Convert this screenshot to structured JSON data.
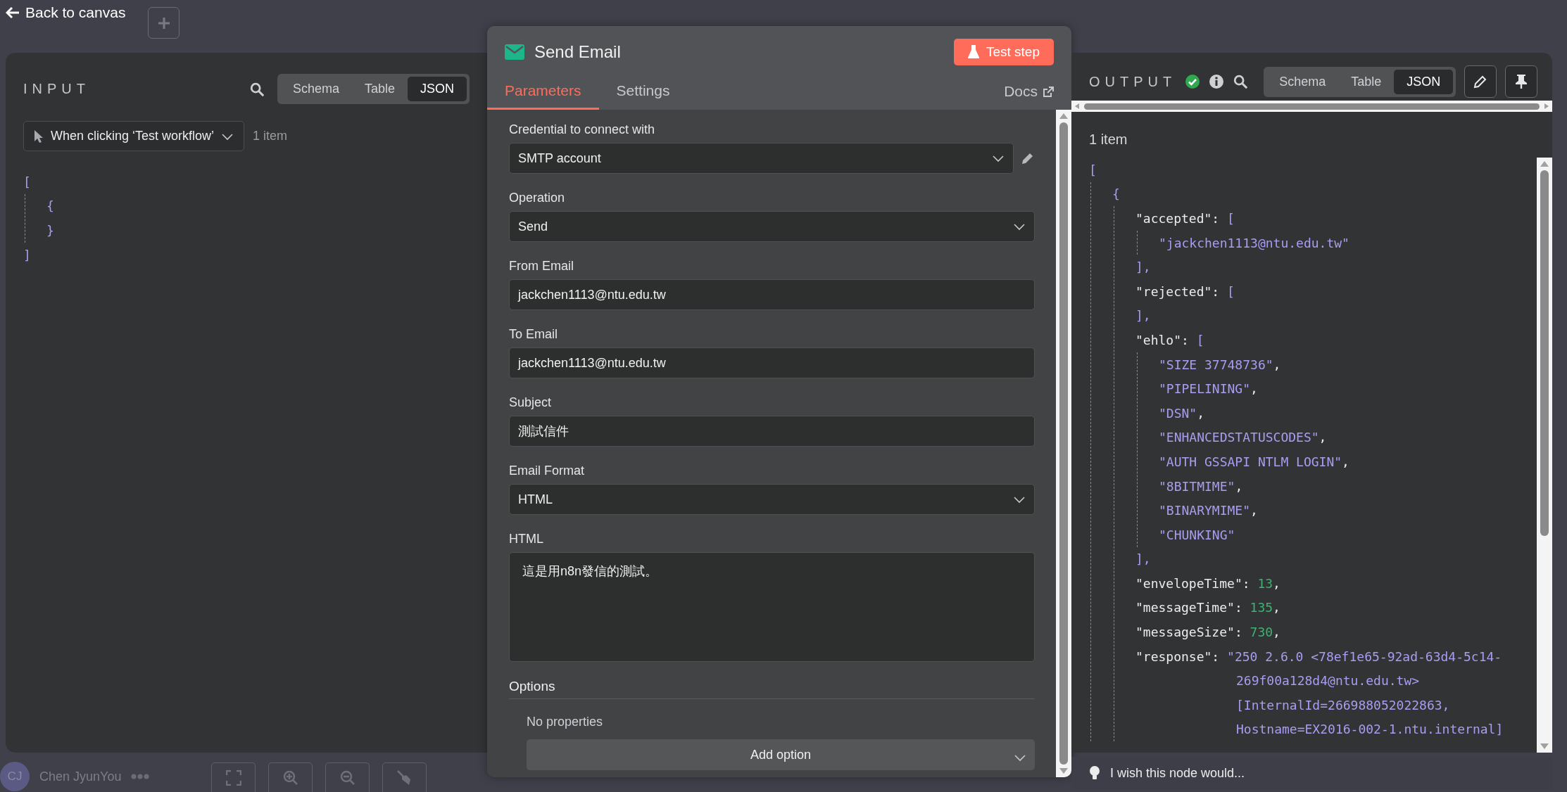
{
  "back_link": "Back to canvas",
  "input": {
    "title": "INPUT",
    "view_tabs": [
      {
        "label": "Schema",
        "selected": false
      },
      {
        "label": "Table",
        "selected": false
      },
      {
        "label": "JSON",
        "selected": true
      }
    ],
    "source_node": "When clicking ‘Test workflow’",
    "item_count": "1 item",
    "json": {
      "open": "[",
      "children": [
        {
          "open": "{",
          "close": "}"
        }
      ],
      "close": "]"
    }
  },
  "node": {
    "title": "Send Email",
    "test_button": "Test step",
    "tabs": [
      {
        "label": "Parameters",
        "selected": true
      },
      {
        "label": "Settings",
        "selected": false
      }
    ],
    "docs_link": "Docs",
    "fields": [
      {
        "label": "Credential to connect with",
        "kind": "select",
        "value": "SMTP account",
        "editable": true
      },
      {
        "label": "Operation",
        "kind": "select",
        "value": "Send",
        "editable": false
      },
      {
        "label": "From Email",
        "kind": "text",
        "value": "jackchen1113@ntu.edu.tw",
        "editable": false
      },
      {
        "label": "To Email",
        "kind": "text",
        "value": "jackchen1113@ntu.edu.tw",
        "editable": false
      },
      {
        "label": "Subject",
        "kind": "text",
        "value": "測試信件",
        "editable": false
      },
      {
        "label": "Email Format",
        "kind": "select",
        "value": "HTML",
        "editable": false
      },
      {
        "label": "HTML",
        "kind": "textarea",
        "value": "這是用n8n發信的測試。",
        "editable": false
      }
    ],
    "options": {
      "title": "Options",
      "empty_text": "No properties",
      "add_button": "Add option"
    }
  },
  "output": {
    "title": "OUTPUT",
    "view_tabs": [
      {
        "label": "Schema",
        "selected": false
      },
      {
        "label": "Table",
        "selected": false
      },
      {
        "label": "JSON",
        "selected": true
      }
    ],
    "item_count": "1 item",
    "json": {
      "open": "[",
      "children": [
        {
          "open": "{",
          "children": [
            {
              "key": "\"accepted\":",
              "open": "[",
              "children": [
                {
                  "kind": "string",
                  "value": "\"jackchen1113@ntu.edu.tw\""
                }
              ],
              "close": "],"
            },
            {
              "key": "\"rejected\":",
              "open": "[",
              "close": "],"
            },
            {
              "key": "\"ehlo\":",
              "open": "[",
              "children": [
                {
                  "kind": "string",
                  "value": "\"SIZE 37748736\"",
                  "suffix": ","
                },
                {
                  "kind": "string",
                  "value": "\"PIPELINING\"",
                  "suffix": ","
                },
                {
                  "kind": "string",
                  "value": "\"DSN\"",
                  "suffix": ","
                },
                {
                  "kind": "string",
                  "value": "\"ENHANCEDSTATUSCODES\"",
                  "suffix": ","
                },
                {
                  "kind": "string",
                  "value": "\"AUTH GSSAPI NTLM LOGIN\"",
                  "suffix": ","
                },
                {
                  "kind": "string",
                  "value": "\"8BITMIME\"",
                  "suffix": ","
                },
                {
                  "kind": "string",
                  "value": "\"BINARYMIME\"",
                  "suffix": ","
                },
                {
                  "kind": "string",
                  "value": "\"CHUNKING\""
                }
              ],
              "close": "],"
            },
            {
              "key": "\"envelopeTime\":",
              "kind": "number",
              "value": "13",
              "suffix": ","
            },
            {
              "key": "\"messageTime\":",
              "kind": "number",
              "value": "135",
              "suffix": ","
            },
            {
              "key": "\"messageSize\":",
              "kind": "number",
              "value": "730",
              "suffix": ","
            },
            {
              "key": "\"response\":",
              "kind": "string",
              "value_lines": [
                "\"250 2.6.0 <78ef1e65-92ad-63d4-5c14-",
                "269f00a128d4@ntu.edu.tw>",
                "[InternalId=266988052022863,",
                "Hostname=EX2016-002-1.ntu.internal]"
              ]
            }
          ]
        }
      ]
    },
    "feedback_placeholder": "I wish this node would..."
  },
  "user": {
    "initials": "CJ",
    "name": "Chen JyunYou"
  }
}
